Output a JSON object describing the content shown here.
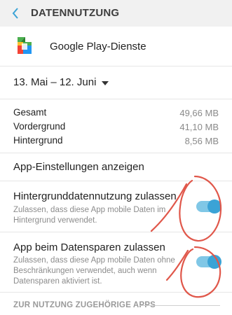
{
  "header": {
    "title": "DATENNUTZUNG"
  },
  "app": {
    "name": "Google Play-Dienste"
  },
  "period": {
    "label": "13. Mai – 12. Juni"
  },
  "stats": [
    {
      "label": "Gesamt",
      "value": "49,66 MB"
    },
    {
      "label": "Vordergrund",
      "value": "41,10 MB"
    },
    {
      "label": "Hintergrund",
      "value": "8,56 MB"
    }
  ],
  "settings_link": "App-Einstellungen anzeigen",
  "options": [
    {
      "title": "Hintergrunddatennutzung zulassen",
      "description": "Zulassen, dass diese App mobile Daten im Hintergrund verwendet.",
      "enabled": true
    },
    {
      "title": "App beim Datensparen zulassen",
      "description": "Zulassen, dass diese App mobile Daten ohne Beschränkungen verwendet, auch wenn Datensparen aktiviert ist.",
      "enabled": true
    }
  ],
  "section_header": "ZUR NUTZUNG ZUGEHÖRIGE APPS",
  "colors": {
    "accent": "#3ba3d6",
    "annotation": "#e0574a"
  }
}
